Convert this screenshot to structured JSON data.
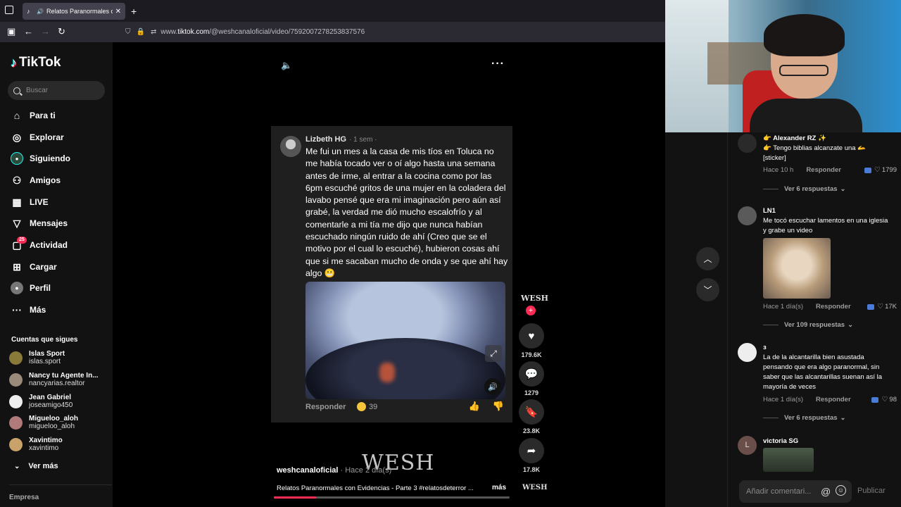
{
  "browser": {
    "tab_title": "Relatos Paranormales con E",
    "tab_close": "✕",
    "new_tab": "+",
    "url_prefix": "www.",
    "url_domain": "tiktok.com",
    "url_path": "/@weshcanaloficial/video/7592007278253837576"
  },
  "sidebar": {
    "logo": "TikTok",
    "search_placeholder": "Buscar",
    "menu": [
      {
        "label": "Para ti",
        "icon": "home-icon"
      },
      {
        "label": "Explorar",
        "icon": "compass-icon"
      },
      {
        "label": "Siguiendo",
        "icon": "following-icon"
      },
      {
        "label": "Amigos",
        "icon": "friends-icon"
      },
      {
        "label": "LIVE",
        "icon": "live-icon"
      },
      {
        "label": "Mensajes",
        "icon": "messages-icon"
      },
      {
        "label": "Actividad",
        "icon": "activity-icon",
        "badge": "25"
      },
      {
        "label": "Cargar",
        "icon": "upload-icon"
      },
      {
        "label": "Perfil",
        "icon": "profile-icon"
      },
      {
        "label": "Más",
        "icon": "more-icon"
      }
    ],
    "following_header": "Cuentas que sigues",
    "following": [
      {
        "name": "Islas Sport",
        "handle": "islas.sport",
        "color": "#8a7a3a"
      },
      {
        "name": "Nancy tu Agente In...",
        "handle": "nancyarias.realtor",
        "color": "#9a8a7a"
      },
      {
        "name": "Jean Gabriel",
        "handle": "joseamigo450",
        "color": "#eeeeee"
      },
      {
        "name": "Migueloo_aloh",
        "handle": "migueloo_aloh",
        "color": "#b07a7a"
      },
      {
        "name": "Xavintimo",
        "handle": "xavintimo",
        "color": "#c9a26a"
      }
    ],
    "see_more": "Ver más",
    "company": "Empresa"
  },
  "video_comment_card": {
    "author": "Lizbeth HG",
    "time": "· 1 sem ·",
    "text": "Me fui un mes a la casa de mis tíos en Toluca no me había tocado ver o oí algo hasta una semana antes de irme, al entrar a la cocina como por las 6pm escuché gritos de una mujer en la coladera del lavabo pensé que era mi imaginación pero aún así grabé, la verdad me dió mucho escalofrío y al comentarle a mi tía me dijo que nunca habían escuchado ningún ruido de ahí (Creo que se el motivo por el cual lo escuché), hubieron cosas ahí que si me sacaban mucho de onda y se que ahí hay algo 😬",
    "reply_label": "Responder",
    "reactions": "39"
  },
  "video": {
    "watermark": "WESH",
    "author": "weshcanaloficial",
    "posted": "· Hace 2 día(s)",
    "description": "Relatos Paranormales con Evidencias - Parte 3 #relatosdeterror ...",
    "more": "más",
    "progress_fraction": 0.18
  },
  "actions": {
    "creator_badge": "WESH",
    "likes": "179.6K",
    "comments": "1279",
    "saves": "23.8K",
    "shares": "17.8K",
    "bottom_badge": "WESH"
  },
  "comments": [
    {
      "name": "👉 Alexander RZ ✨",
      "text": "👉 Tengo biblias alcanzate una 🫴 [sticker]",
      "time": "Hace 10 h",
      "reply": "Responder",
      "likes": "1799",
      "more": "Ver 6 respuestas"
    },
    {
      "name": "LN1",
      "text": "Me tocó escuchar lamentos en una iglesia y grabe un video",
      "time": "Hace 1 día(s)",
      "reply": "Responder",
      "likes": "17K",
      "more": "Ver 109 respuestas"
    },
    {
      "name": "з",
      "text": "La de la alcantarilla bien asustada pensando que era algo paranormal, sin saber que las alcantarillas suenan así la mayoría de veces",
      "time": "Hace 1 día(s)",
      "reply": "Responder",
      "likes": "98",
      "more": "Ver 6 respuestas"
    },
    {
      "name": "victoria SG",
      "avatar_letter": "L"
    }
  ],
  "comment_input": {
    "placeholder": "Añadir comentari...",
    "at": "@",
    "post": "Publicar"
  }
}
